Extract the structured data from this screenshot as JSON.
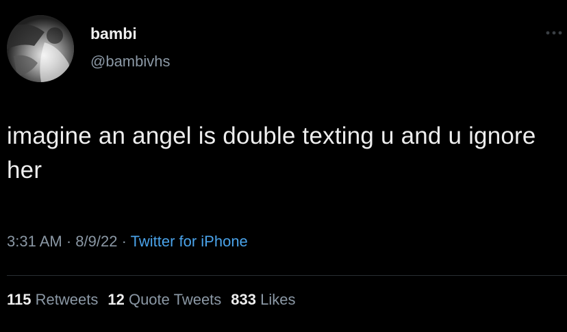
{
  "user": {
    "display_name": "bambi",
    "handle": "@bambivhs",
    "avatar_icon": "profile-photo"
  },
  "tweet": {
    "text": "imagine an angel is double texting u and u ignore her"
  },
  "meta": {
    "time": "3:31 AM",
    "separator1": " · ",
    "date": "8/9/22",
    "separator2": " · ",
    "source": "Twitter for iPhone"
  },
  "stats": {
    "retweets_count": "115",
    "retweets_label": "Retweets",
    "quotes_count": "12",
    "quotes_label": "Quote Tweets",
    "likes_count": "833",
    "likes_label": "Likes"
  },
  "colors": {
    "background": "#000000",
    "primary_text": "#eeeeee",
    "secondary_text": "#8b98a5",
    "link": "#4aa3ea",
    "divider": "#2a2f33"
  }
}
